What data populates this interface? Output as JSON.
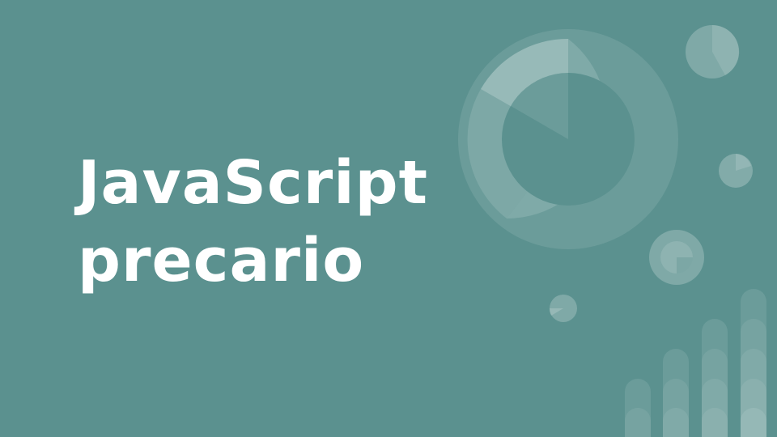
{
  "slide": {
    "background_color": "#5b918f",
    "accent_color": "#ffffff",
    "title_lines": [
      "JavaScript",
      "precario"
    ]
  },
  "decorations": {
    "description_icons": [
      "donut-chart-graphic",
      "pie-chart-circles",
      "bar-columns-graphic"
    ]
  }
}
